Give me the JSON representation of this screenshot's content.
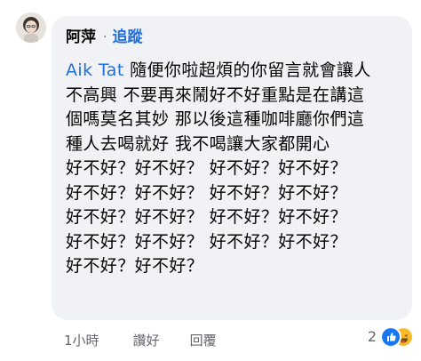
{
  "comment": {
    "author": "阿萍",
    "separator": "·",
    "follow_label": "追蹤",
    "mention": "Aik Tat",
    "lines": [
      " 隨便你啦超煩的你留言就會讓人",
      "不高興 不要再來鬧好不好重點是在講這",
      "個嗎莫名其妙 那以後這種咖啡廳你們這",
      "種人去喝就好 我不喝讓大家都開心",
      "好不好？好不好？ 好不好？好不好？",
      "好不好？好不好？ 好不好？好不好？",
      "好不好？好不好？ 好不好？好不好？",
      "好不好？好不好？ 好不好？好不好？",
      "好不好？好不好？"
    ]
  },
  "actions": {
    "time": "1小時",
    "like_label": "讚好",
    "reply_label": "回覆"
  },
  "reactions": {
    "count": "2",
    "icons": [
      "like-icon",
      "haha-icon"
    ],
    "colors": {
      "like": "#1877f2",
      "haha": "#f7b928"
    }
  },
  "colors": {
    "bubble": "#f0f2f5",
    "link": "#216fdb",
    "meta": "#65676b",
    "text": "#050505"
  }
}
